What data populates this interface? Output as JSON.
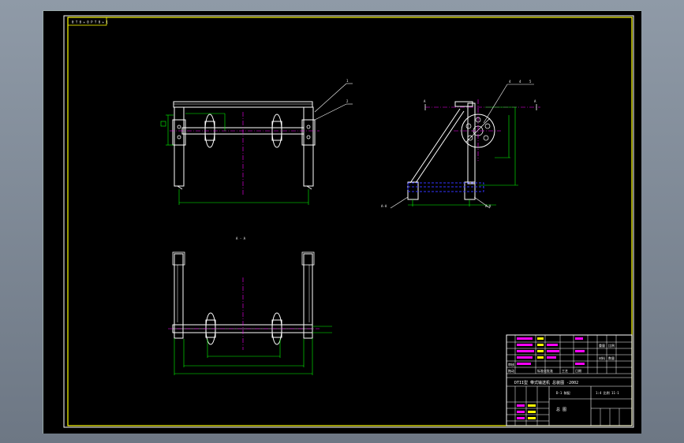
{
  "drawing": {
    "corner_tag": "0 T 0 + 0 P T 0 + 1",
    "section_label": "A - A",
    "part_numbers": [
      "1",
      "2"
    ],
    "side_view_callouts": [
      "4",
      "4",
      "5"
    ],
    "view_markers": [
      "A",
      "A"
    ],
    "base_labels": [
      "A-A",
      "A-A"
    ],
    "title_block": {
      "main_title": "DTII型 带式输送机 总装图 -2002",
      "drawing_number": "D-1 装配",
      "scale_field": "1:4 比例  11-1",
      "name_row": "总   图",
      "left_cells": [
        "拖动",
        "审核",
        "标准化",
        "批准",
        "工艺",
        "日期"
      ],
      "mid_cells": [
        "重量",
        "比例",
        "材料",
        "数量"
      ]
    },
    "colors": {
      "background": "#000000",
      "frame": "#ffff00",
      "outline": "#ffffff",
      "dimension": "#00ff00",
      "hidden": "#3333ff",
      "centerline": "#ff00ff",
      "leader": "#ffffff"
    }
  }
}
